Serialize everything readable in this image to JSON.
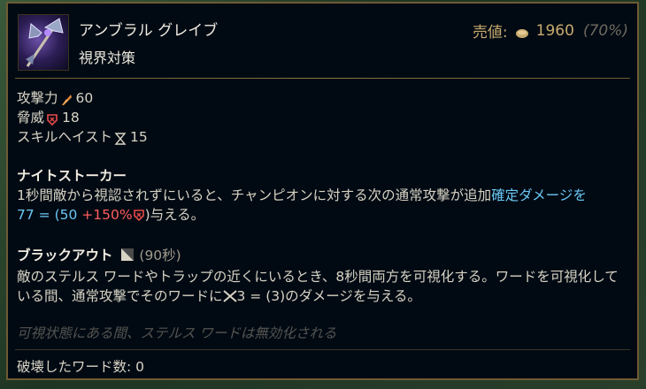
{
  "item": {
    "name": "アンブラル グレイブ",
    "subtitle": "視界対策",
    "price_label": "売値:",
    "price_value": "1960",
    "price_percent": "(70%)"
  },
  "stats": [
    {
      "label": "攻撃力",
      "icon": "attack-damage-icon",
      "value": "60"
    },
    {
      "label": "脅威",
      "icon": "lethality-icon",
      "value": "18"
    },
    {
      "label": "スキルヘイスト",
      "icon": "ability-haste-icon",
      "value": "15"
    }
  ],
  "passive1": {
    "title": "ナイトストーカー",
    "line1_a": "1秒間敵から視認されずにいると、チャンピオンに対する次の通常攻撃が追加",
    "line1_b": "確定ダメージを",
    "line2_a": "77 = (50 ",
    "line2_b": "+150%",
    "line2_c": ")与える。"
  },
  "passive2": {
    "title": "ブラックアウト",
    "cooldown": "(90秒)",
    "line1": "敵のステルス ワードやトラップの近くにいるとき、8秒間両方を可視化する。ワードを可視化して",
    "line2_a": "いる間、通常攻撃でそのワードに",
    "line2_b": "3 = (3)のダメージを与える。"
  },
  "flavor": "可視状態にある間、ステルス ワードは無効化される",
  "stack": {
    "label": "破壊したワード数:",
    "value": "0"
  },
  "colors": {
    "border": "#6e5b34",
    "gold": "#c8aa6e",
    "true_damage": "#6cc7f5",
    "lethality": "#ff5d5d"
  }
}
